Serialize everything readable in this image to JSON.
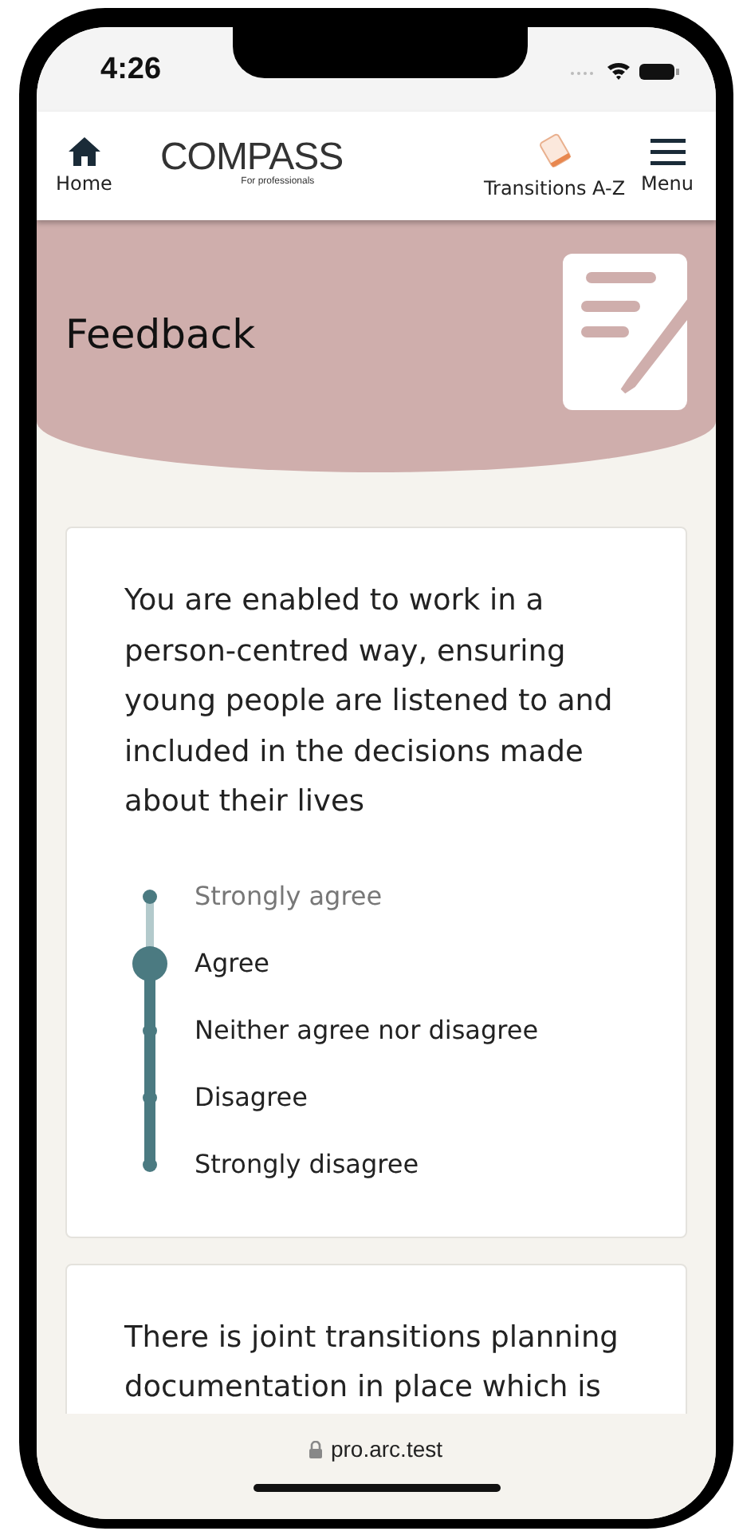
{
  "status_bar": {
    "time": "4:26"
  },
  "nav": {
    "home": "Home",
    "logo": "COMPASS",
    "logo_tagline": "For professionals",
    "transitions": "Transitions A-Z",
    "menu": "Menu"
  },
  "banner": {
    "title": "Feedback"
  },
  "questions": [
    {
      "text": "You are enabled to work in a person-centred way, ensuring young people are listened to and included in the decisions made about their lives",
      "options": [
        {
          "label": "Strongly agree",
          "selected": false
        },
        {
          "label": "Agree",
          "selected": true
        },
        {
          "label": "Neither agree nor disagree",
          "selected": false
        },
        {
          "label": "Disagree",
          "selected": false
        },
        {
          "label": "Strongly disagree",
          "selected": false
        }
      ]
    },
    {
      "text": "There is joint transitions planning documentation in place which is"
    }
  ],
  "browser": {
    "url": "pro.arc.test"
  }
}
